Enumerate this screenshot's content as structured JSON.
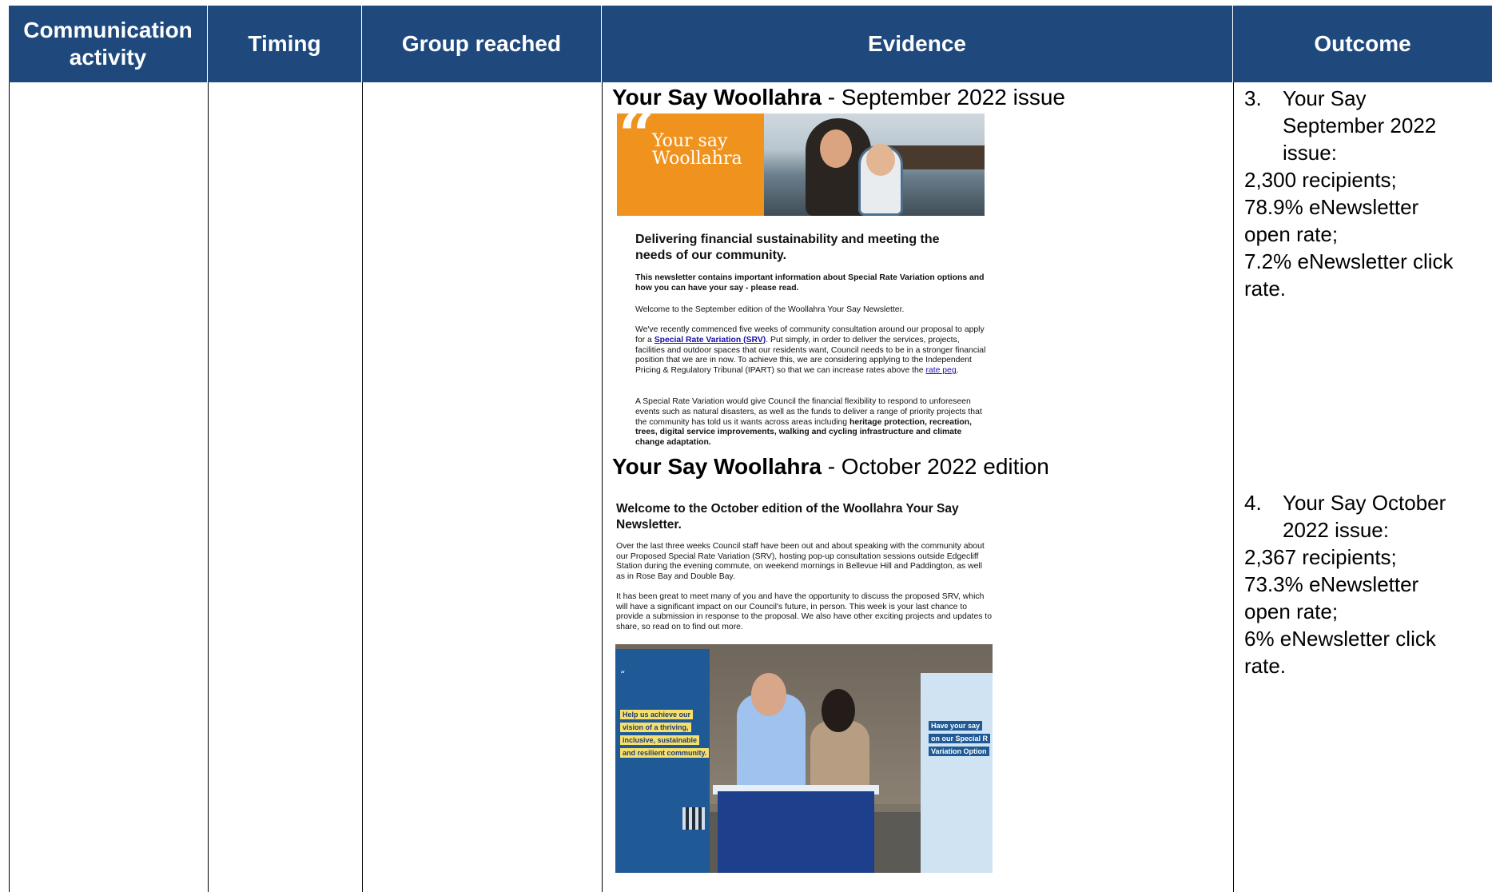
{
  "headers": [
    "Communication activity",
    "Timing",
    "Group reached",
    "Evidence",
    "Outcome"
  ],
  "evidence": {
    "item1": {
      "title_bold": "Your Say Woollahra",
      "title_rest": " - September 2022 issue",
      "banner_brand_line1": "Your say",
      "banner_brand_line2": "Woollahra",
      "heading": "Delivering financial sustainability and meeting the needs of our community.",
      "intro": "This newsletter contains important information about Special Rate Variation options and how you can have your say - please read.",
      "welcome": "Welcome to the September edition of the Woollahra Your Say Newsletter.",
      "p1_a": "We've recently commenced five weeks of community consultation around our proposal to apply for a ",
      "p1_link": "Special Rate Variation (SRV)",
      "p1_b": ". Put simply, in order to deliver the services, projects, facilities and outdoor spaces that our residents want, Council needs to be in a stronger financial position that we are in now. To achieve this, we are considering applying to the Independent Pricing & Regulatory Tribunal (IPART) so that we can increase rates above the ",
      "p1_link2": "rate peg",
      "p1_c": ".",
      "p2_a": "A Special Rate Variation would give Council the financial flexibility to respond to unforeseen events such as natural disasters, as well as the funds to deliver a range of priority projects that the community has told us it wants across areas including ",
      "p2_bold": "heritage protection, recreation, trees, digital service improvements, walking and cycling infrastructure and climate change adaptation."
    },
    "item2": {
      "title_bold": "Your Say Woollahra",
      "title_rest": " - October 2022 edition",
      "heading": "Welcome to the October edition of the Woollahra Your Say Newsletter.",
      "p1": "Over the last three weeks Council staff have been out and about speaking with the community about our Proposed Special Rate Variation (SRV), hosting pop-up consultation sessions outside Edgecliff Station during the evening commute, on weekend mornings in Bellevue Hill and Paddington, as well as in Rose Bay and Double Bay.",
      "p2": "It has been great to meet many of you and have the opportunity to discuss the proposed SRV, which will have a significant impact on our Council's future, in person. This week is your last chance to provide a submission in response to the proposal. We also have other exciting projects and updates to share, so read on to find out more.",
      "photo_banner_left": [
        "Help us achieve our",
        "vision of a thriving,",
        "inclusive, sustainable",
        "and resilient community."
      ],
      "photo_banner_right": [
        "Have your say",
        "on our Special R",
        "Variation Option"
      ]
    }
  },
  "outcome": {
    "item1": {
      "num": "3.",
      "lines": [
        "Your Say",
        "September 2022",
        "issue:"
      ],
      "recipients": "2,300 recipients;",
      "open1": "78.9% eNewsletter",
      "open2": "open rate;",
      "click1": "7.2% eNewsletter click",
      "click2": "rate."
    },
    "item2": {
      "num": "4.",
      "lines": [
        "Your Say October",
        "2022 issue:"
      ],
      "recipients": "2,367 recipients;",
      "open1": "73.3% eNewsletter",
      "open2": "open rate;",
      "click1": "6% eNewsletter click",
      "click2": "rate."
    }
  },
  "colors": {
    "header_bg": "#1f497d",
    "banner_orange": "#f0931e"
  }
}
